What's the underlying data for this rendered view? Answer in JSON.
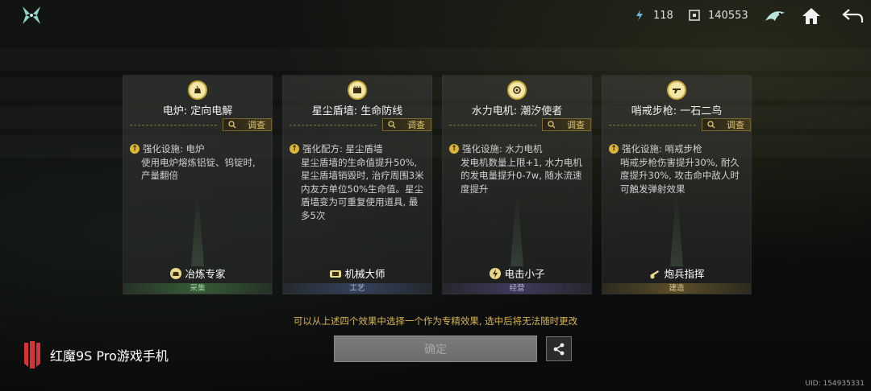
{
  "top": {
    "currency1": {
      "icon": "shard-icon",
      "value": "118"
    },
    "currency2": {
      "icon": "chip-icon",
      "value": "140553"
    }
  },
  "cards": [
    {
      "icon": "furnace-icon",
      "title": "电炉: 定向电解",
      "inspect": "调查",
      "effect_title": "强化设施: 电炉",
      "effect_desc": "使用电炉熔炼铝锭、钨锭时, 产量翻倍",
      "role": "冶炼专家",
      "category": "采集",
      "accent": "#3f6f3f",
      "accent_text": "#a6cfa0"
    },
    {
      "icon": "shield-wall-icon",
      "title": "星尘盾墙: 生命防线",
      "inspect": "调查",
      "effect_title": "强化配方: 星尘盾墙",
      "effect_desc": "星尘盾墙的生命值提升50%, 星尘盾墙销毁时, 治疗周围3米内友方单位50%生命值。星尘盾墙变为可重复使用道具, 最多5次",
      "role": "机械大师",
      "category": "工艺",
      "accent": "#3a4a6b",
      "accent_text": "#a9b7d8"
    },
    {
      "icon": "generator-icon",
      "title": "水力电机: 潮汐使者",
      "inspect": "调查",
      "effect_title": "强化设施: 水力电机",
      "effect_desc": "发电机数量上限+1, 水力电机的发电量提升0-7w, 随水流速度提升",
      "role": "电击小子",
      "category": "经营",
      "accent": "#4a3f6b",
      "accent_text": "#b8aed8"
    },
    {
      "icon": "rifle-icon",
      "title": "哨戒步枪: 一石二鸟",
      "inspect": "调查",
      "effect_title": "强化设施: 哨戒步枪",
      "effect_desc": "哨戒步枪伤害提升30%, 耐久度提升30%, 攻击命中敌人时可触发弹射效果",
      "role": "炮兵指挥",
      "category": "建造",
      "accent": "#6b5a2a",
      "accent_text": "#d8c690"
    }
  ],
  "hint": "可以从上述四个效果中选择一个作为专精效果, 选中后将无法随时更改",
  "confirm_label": "确定",
  "watermark": "红魔9S Pro游戏手机",
  "uid": "UID: 154935331",
  "colors": {
    "gold": "#d9b64a",
    "inspect_text": "#e3c86a"
  }
}
